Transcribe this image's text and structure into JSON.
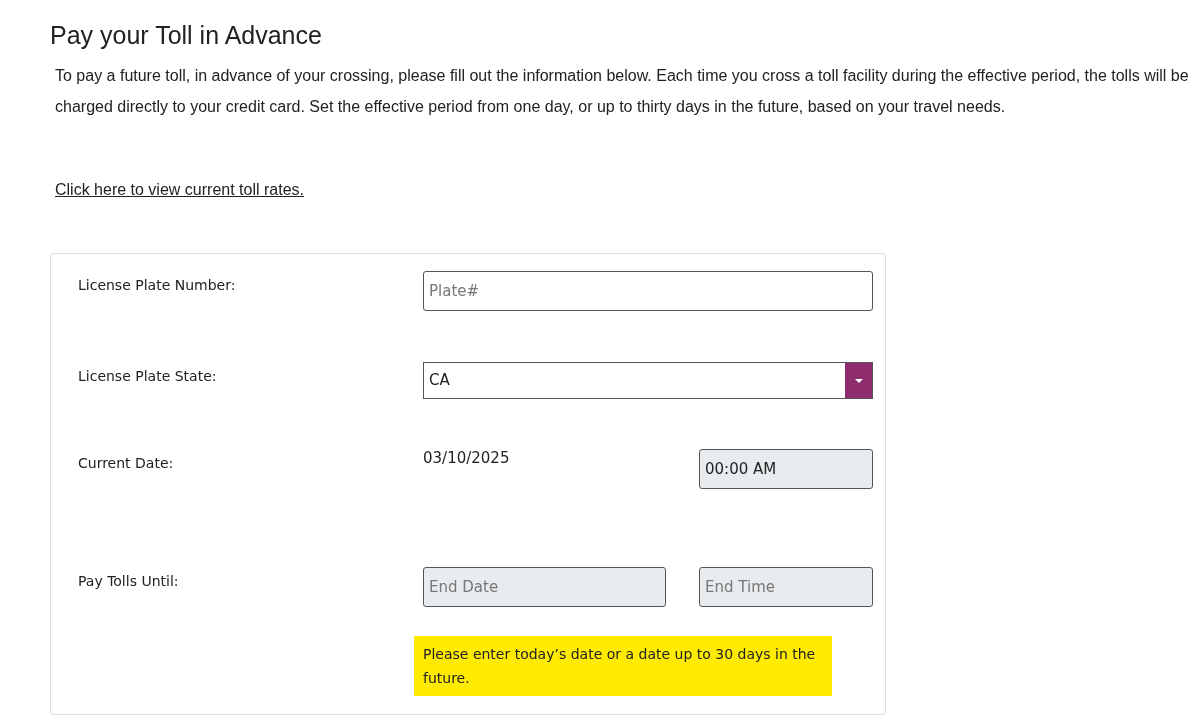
{
  "title": "Pay your Toll in Advance",
  "intro": "To pay a future toll, in advance of your crossing, please fill out the information below. Each time you cross a toll facility during the effective period, the tolls will be charged directly to your credit card. Set the effective period from one day, or up to thirty days in the future, based on your travel needs.",
  "rates_link": "Click here to view current toll rates.",
  "form": {
    "rows": [
      {
        "kind": "text",
        "label": "License Plate Number:",
        "field": {
          "placeholder": "Plate#",
          "disabled": false
        }
      },
      {
        "kind": "select",
        "label": "License Plate State:",
        "field": {
          "value": "CA"
        }
      },
      {
        "kind": "date_time",
        "label": "Current Date:",
        "date": "03/10/2025",
        "time": {
          "value": "00:00 AM",
          "disabled": true
        }
      },
      {
        "kind": "range_end",
        "label": "Pay Tolls Until:",
        "end_date": {
          "placeholder": "End Date",
          "disabled": true
        },
        "end_time": {
          "placeholder": "End Time",
          "disabled": true
        }
      }
    ],
    "note": {
      "text": "Please enter today’s date or a date up to 30 days in the future.",
      "highlighted": true
    }
  }
}
